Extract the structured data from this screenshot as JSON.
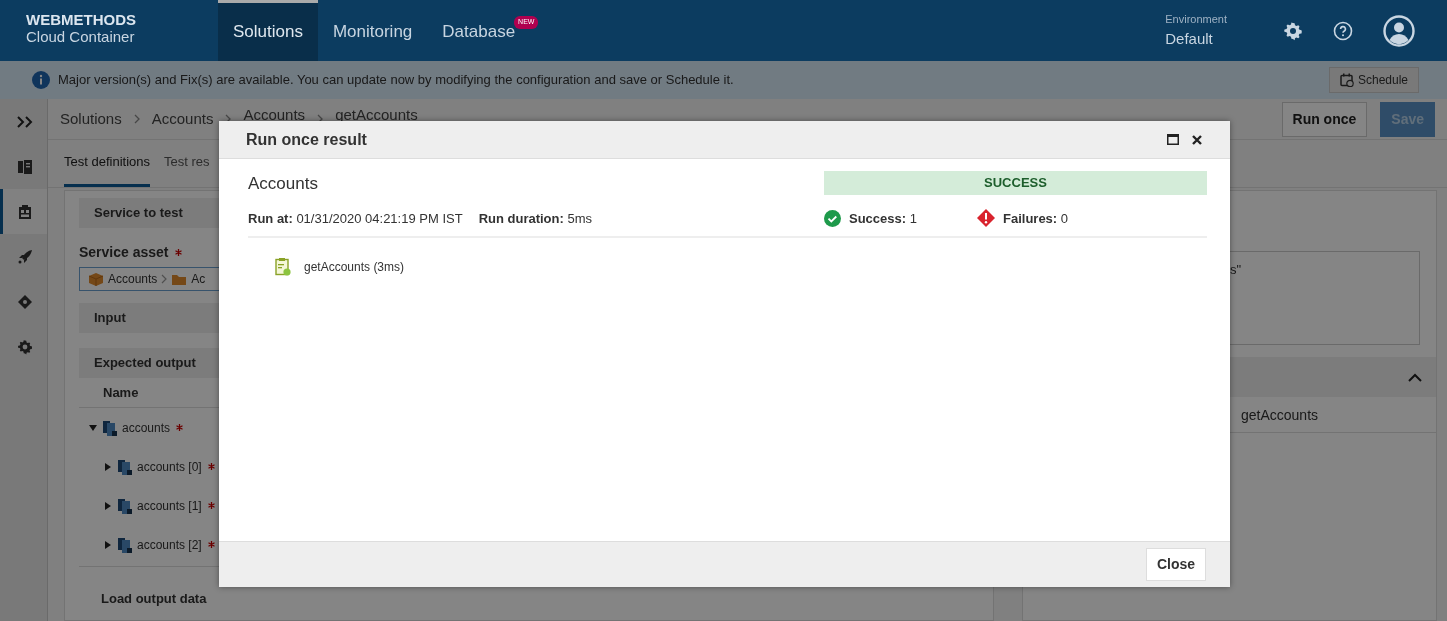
{
  "header": {
    "brand": "WEBMETHODS",
    "product": "Cloud Container",
    "nav": [
      {
        "label": "Solutions",
        "selected": true
      },
      {
        "label": "Monitoring",
        "selected": false
      },
      {
        "label": "Database",
        "selected": false,
        "badge": "NEW"
      }
    ],
    "environment_label": "Environment",
    "environment": "Default"
  },
  "notice": {
    "text": "Major version(s) and Fix(s) are available. You can update now by modifying the configuration and save or Schedule it.",
    "button": "Schedule"
  },
  "sidebar": {
    "items": [
      {
        "kind": "book",
        "selected": false
      },
      {
        "kind": "clipboard",
        "selected": true
      },
      {
        "kind": "rocket",
        "selected": false
      },
      {
        "kind": "diamond",
        "selected": false
      },
      {
        "kind": "gear",
        "selected": false
      }
    ]
  },
  "breadcrumb": [
    "Solutions",
    "Accounts",
    "Accounts",
    "getAccounts"
  ],
  "actions": [
    {
      "label": "Run once",
      "disabled": false
    },
    {
      "label": "Save",
      "disabled": true
    }
  ],
  "tabs": [
    {
      "label": "Test definitions",
      "selected": true
    },
    {
      "label": "Test res",
      "selected": false
    }
  ],
  "left_panel": {
    "service_heading": "Service to test",
    "asset_label": "Service asset",
    "asset_required": true,
    "asset_path": [
      "Accounts",
      "Ac"
    ],
    "input_heading": "Input",
    "output_heading": "Expected output",
    "column": "Name",
    "tree": [
      {
        "label": "accounts",
        "required": true,
        "expanded": true,
        "children": [
          {
            "label": "accounts [0]",
            "required": true,
            "expanded": false
          },
          {
            "label": "accounts [1]",
            "required": true,
            "expanded": false
          },
          {
            "label": "accounts [2]",
            "required": true,
            "expanded": false
          }
        ]
      }
    ],
    "load_heading": "Load output data"
  },
  "right_panel": {
    "snippet": "s\"",
    "item": "getAccounts"
  },
  "modal": {
    "title": "Run once result",
    "heading": "Accounts",
    "status": "SUCCESS",
    "run_at": "**Run at:** 01/31/2020 04:21:19 PM IST",
    "run_duration": "**Run duration:** 5ms",
    "success": "**Success:** 1",
    "failures": "**Failures:** 0",
    "results": [
      {
        "name": "getAccounts (3ms)"
      }
    ],
    "close": "Close"
  }
}
